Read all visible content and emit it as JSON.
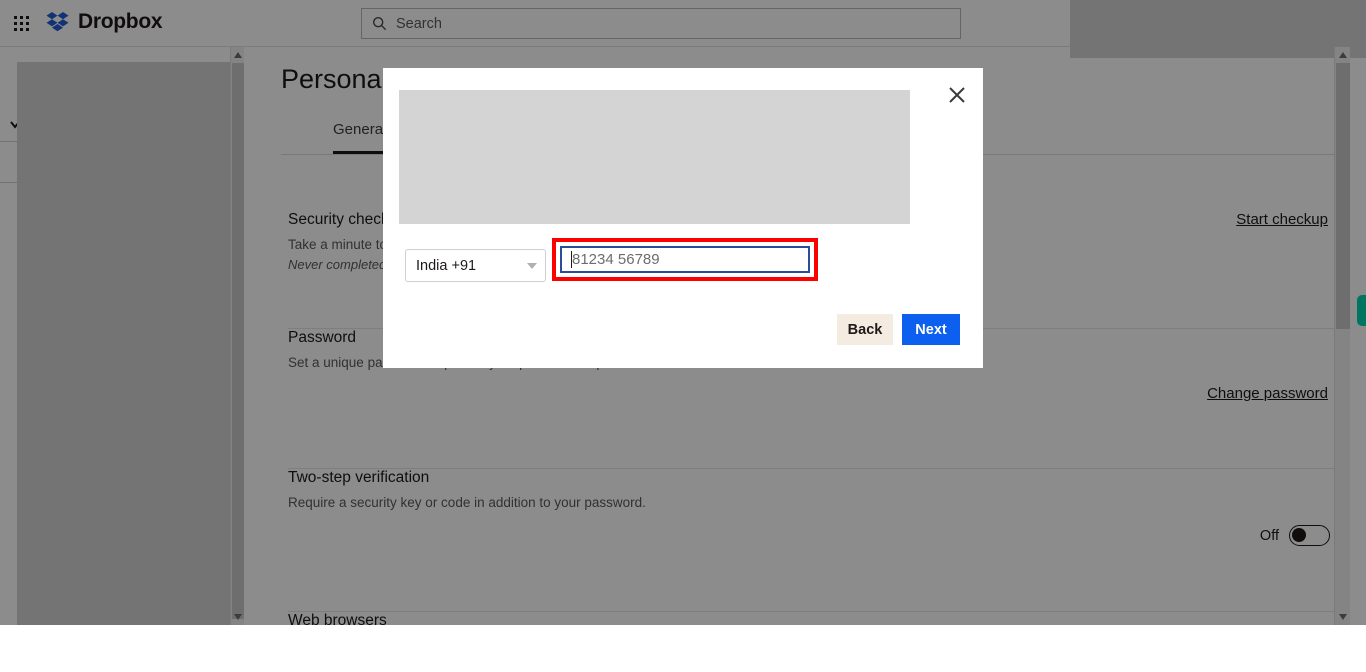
{
  "topbar": {
    "app_grid_icon": "grid-apps-icon",
    "brand_name": "Dropbox",
    "brand_logo_icon": "dropbox-logo-icon",
    "search": {
      "icon": "search-icon",
      "placeholder": "Search",
      "value": ""
    }
  },
  "settings": {
    "page_title": "Personal",
    "tabs": [
      {
        "label": "General",
        "active": true
      }
    ],
    "rows": [
      {
        "title": "Security checkup",
        "description": "Take a minute to review your security settings.",
        "sub": "Never completed",
        "action": "Start checkup"
      },
      {
        "title": "Password",
        "description": "Set a unique password to protect your personal Dropbox account.",
        "action": "Change password"
      },
      {
        "title": "Two-step verification",
        "description": "Require a security key or code in addition to your password.",
        "toggle_label": "Off",
        "toggle_state": "off"
      },
      {
        "title": "Web browsers"
      }
    ]
  },
  "modal": {
    "close_icon": "close-icon",
    "country": {
      "selected": "India +91",
      "chevron_icon": "chevron-down-icon"
    },
    "phone": {
      "placeholder": "81234 56789",
      "value": ""
    },
    "back_label": "Back",
    "next_label": "Next"
  },
  "colors": {
    "accent_blue": "#0c5fef",
    "back_button": "#f5ece1",
    "highlight_red": "#ff0000",
    "focus_border": "#2b4b9b",
    "scroll_handle_teal": "#00d6ae"
  }
}
